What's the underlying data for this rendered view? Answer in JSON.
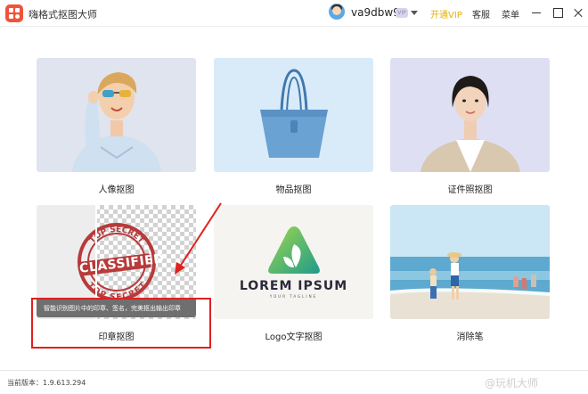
{
  "app": {
    "title": "嗨格式抠图大师"
  },
  "header": {
    "username": "va9dbw9",
    "vip_badge": "VIP",
    "open_vip": "开通VIP",
    "customer_service": "客服",
    "menu": "菜单"
  },
  "cards": [
    {
      "label": "人像抠图"
    },
    {
      "label": "物品抠图"
    },
    {
      "label": "证件照抠图"
    },
    {
      "label": "印章抠图",
      "tooltip": "智能识别图片中的印章、签名，完美抠出输出印章",
      "stamp_text": "CLASSIFIED",
      "stamp_ring_top": "TOP SECRET",
      "stamp_ring_bottom": "TOP SECRET"
    },
    {
      "label": "Logo文字抠图",
      "logo_text": "LOREM IPSUM",
      "logo_tagline": "YOUR TAGLINE"
    },
    {
      "label": "消除笔"
    }
  ],
  "status": {
    "version": "当前版本：1.9.613.294"
  },
  "watermark": "@玩机大师",
  "colors": {
    "accent": "#f0533a",
    "vip": "#e5b100",
    "highlight": "#e02020"
  }
}
